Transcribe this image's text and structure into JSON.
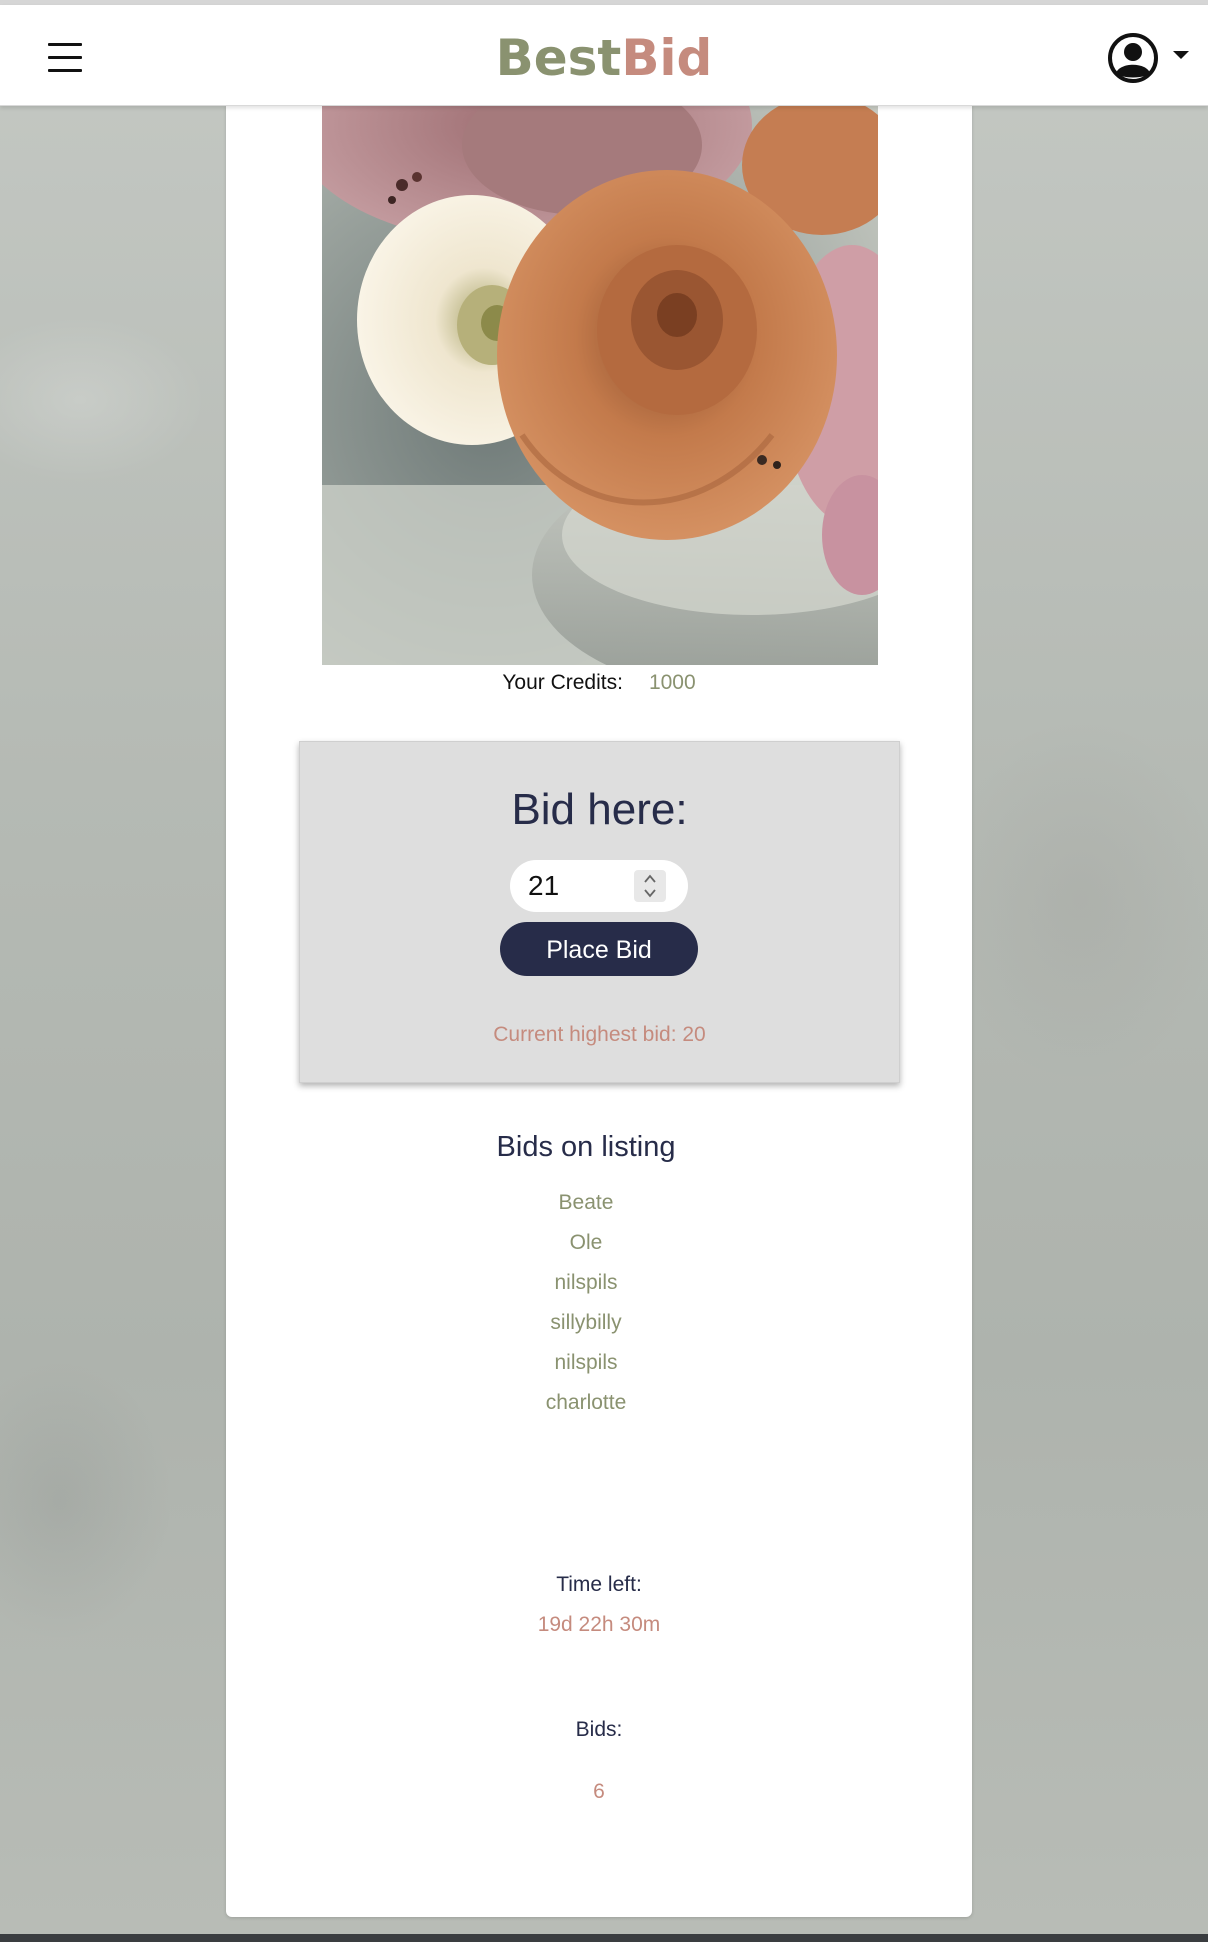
{
  "header": {
    "logo_part1": "Best",
    "logo_part2": "Bid",
    "menu_icon": "hamburger-menu-icon",
    "user_icon": "user-circle-icon",
    "dropdown_icon": "caret-down-icon"
  },
  "listing": {
    "image_subject": "bouquet of peach roses, cream ranunculus and mauve peonies in a grey vase"
  },
  "credits": {
    "label": "Your Credits:",
    "value": "1000"
  },
  "bid_form": {
    "title": "Bid here:",
    "amount": "21",
    "button_label": "Place Bid",
    "current_highest": "Current highest bid: 20"
  },
  "bids_list": {
    "title": "Bids on listing",
    "bidders": [
      "Beate",
      "Ole",
      "nilspils",
      "sillybilly",
      "nilspils",
      "charlotte"
    ]
  },
  "stats": {
    "time_left_label": "Time left:",
    "time_left_value": "19d 22h 30m",
    "bids_label": "Bids:",
    "bids_value": "6"
  },
  "colors": {
    "navy": "#272c49",
    "olive": "#8a9270",
    "rose": "#c58b7e",
    "panel": "#dedede"
  }
}
